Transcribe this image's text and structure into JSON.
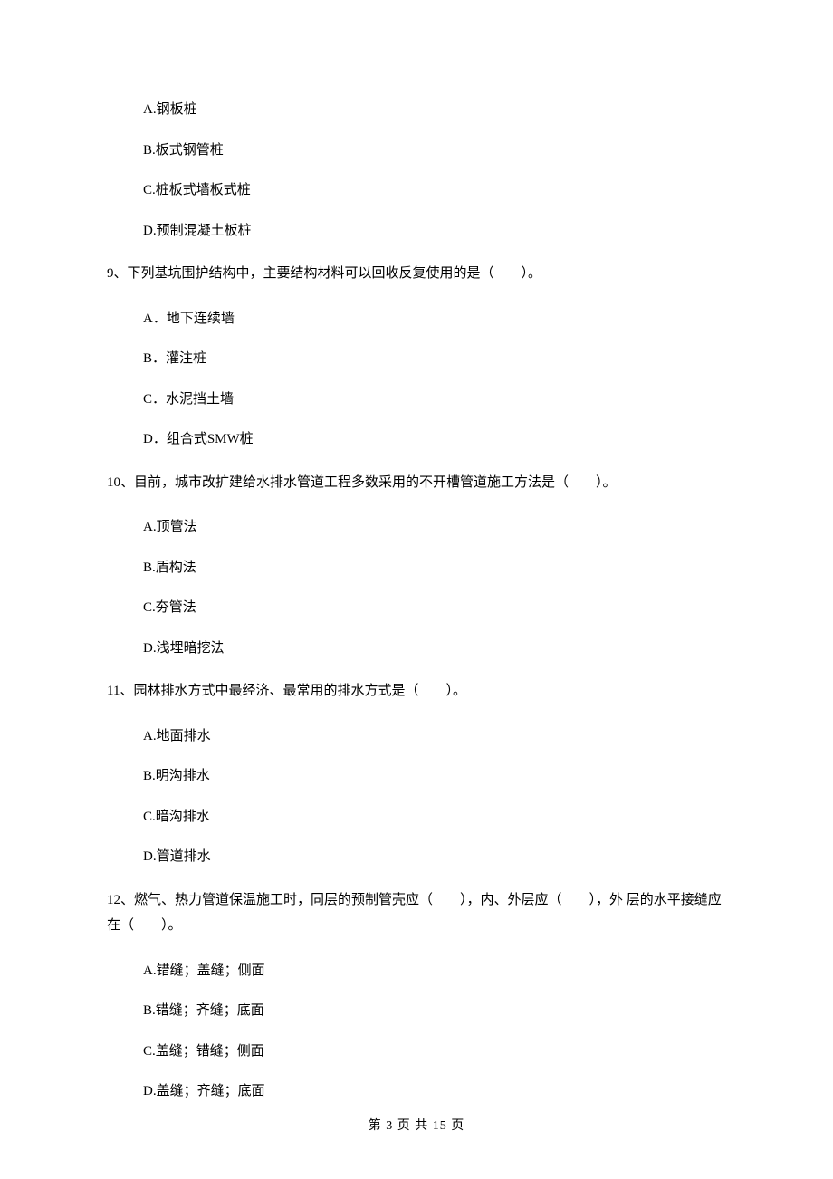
{
  "orphan_options": {
    "a": "A.钢板桩",
    "b": "B.板式钢管桩",
    "c": "C.桩板式墙板式桩",
    "d": "D.预制混凝土板桩"
  },
  "q9": {
    "text": "9、下列基坑围护结构中，主要结构材料可以回收反复使用的是（　　）。",
    "a": "A．地下连续墙",
    "b": "B．灌注桩",
    "c": "C．水泥挡土墙",
    "d": "D．组合式SMW桩"
  },
  "q10": {
    "text": "10、目前，城市改扩建给水排水管道工程多数采用的不开槽管道施工方法是（　　）。",
    "a": "A.顶管法",
    "b": "B.盾构法",
    "c": "C.夯管法",
    "d": "D.浅埋暗挖法"
  },
  "q11": {
    "text": "11、园林排水方式中最经济、最常用的排水方式是（　　）。",
    "a": "A.地面排水",
    "b": "B.明沟排水",
    "c": "C.暗沟排水",
    "d": "D.管道排水"
  },
  "q12": {
    "text": "12、燃气、热力管道保温施工时，同层的预制管壳应（　　），内、外层应（　　），外 层的水平接缝应在（　　）。",
    "a": "A.错缝；盖缝；侧面",
    "b": "B.错缝；齐缝；底面",
    "c": "C.盖缝；错缝；侧面",
    "d": "D.盖缝；齐缝；底面"
  },
  "footer": "第 3 页 共 15 页"
}
